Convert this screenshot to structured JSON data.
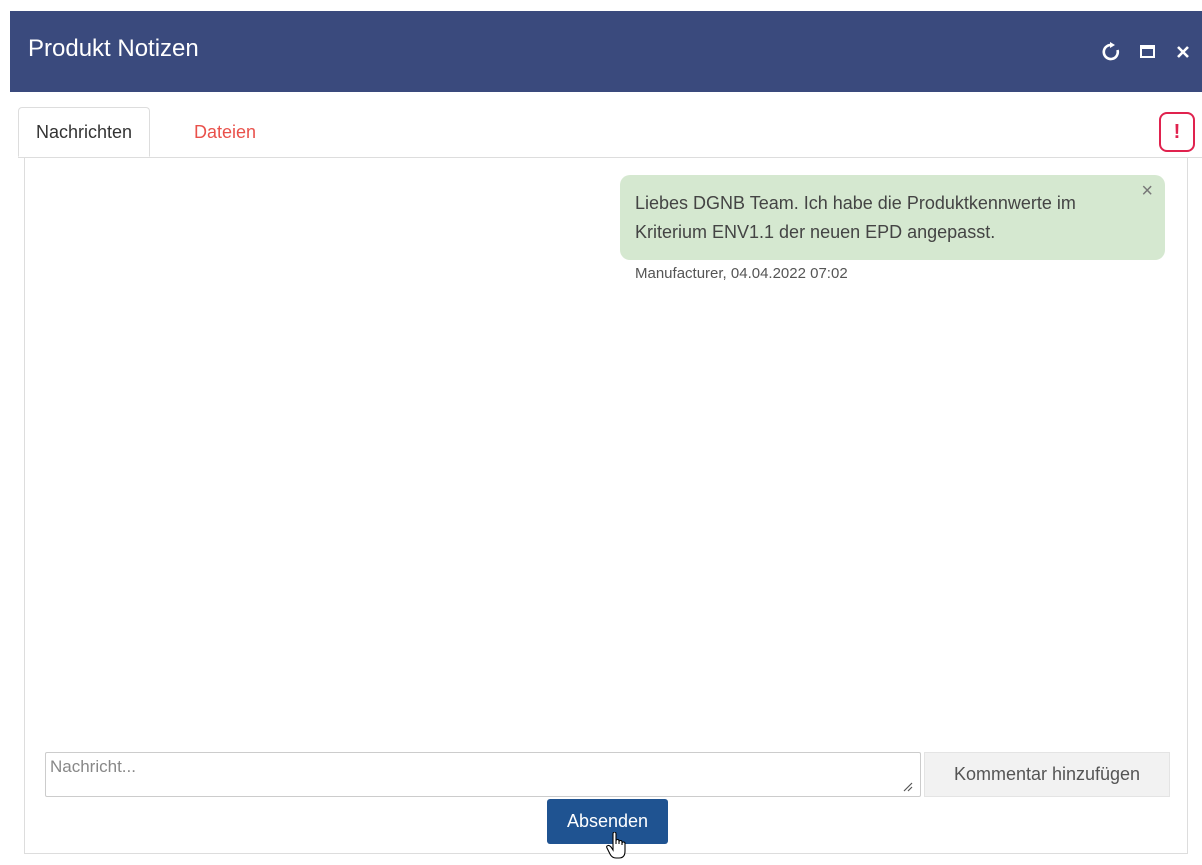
{
  "window": {
    "title": "Produkt Notizen",
    "controls": [
      {
        "icon": "refresh-icon"
      },
      {
        "icon": "maximize-icon"
      },
      {
        "icon": "close-icon"
      }
    ]
  },
  "tabs": [
    {
      "label": "Nachrichten",
      "active": true
    },
    {
      "label": "Dateien",
      "active": false
    }
  ],
  "alert": {
    "symbol": "!",
    "color": "#e0224e"
  },
  "messages": [
    {
      "text": "Liebes DGNB Team. Ich habe die Produktkennwerte im Kriterium ENV1.1 der neuen EPD angepasst.",
      "author_time": "Manufacturer, 04.04.2022 07:02",
      "dismiss_symbol": "×"
    }
  ],
  "composer": {
    "placeholder": "Nachricht...",
    "add_comment_label": "Kommentar hinzufügen",
    "send_label": "Absenden"
  },
  "colors": {
    "titlebar": "#3a4a7d",
    "inactive_tab": "#e9514b",
    "bubble": "#d5e8d0",
    "send_button": "#1f5391"
  }
}
